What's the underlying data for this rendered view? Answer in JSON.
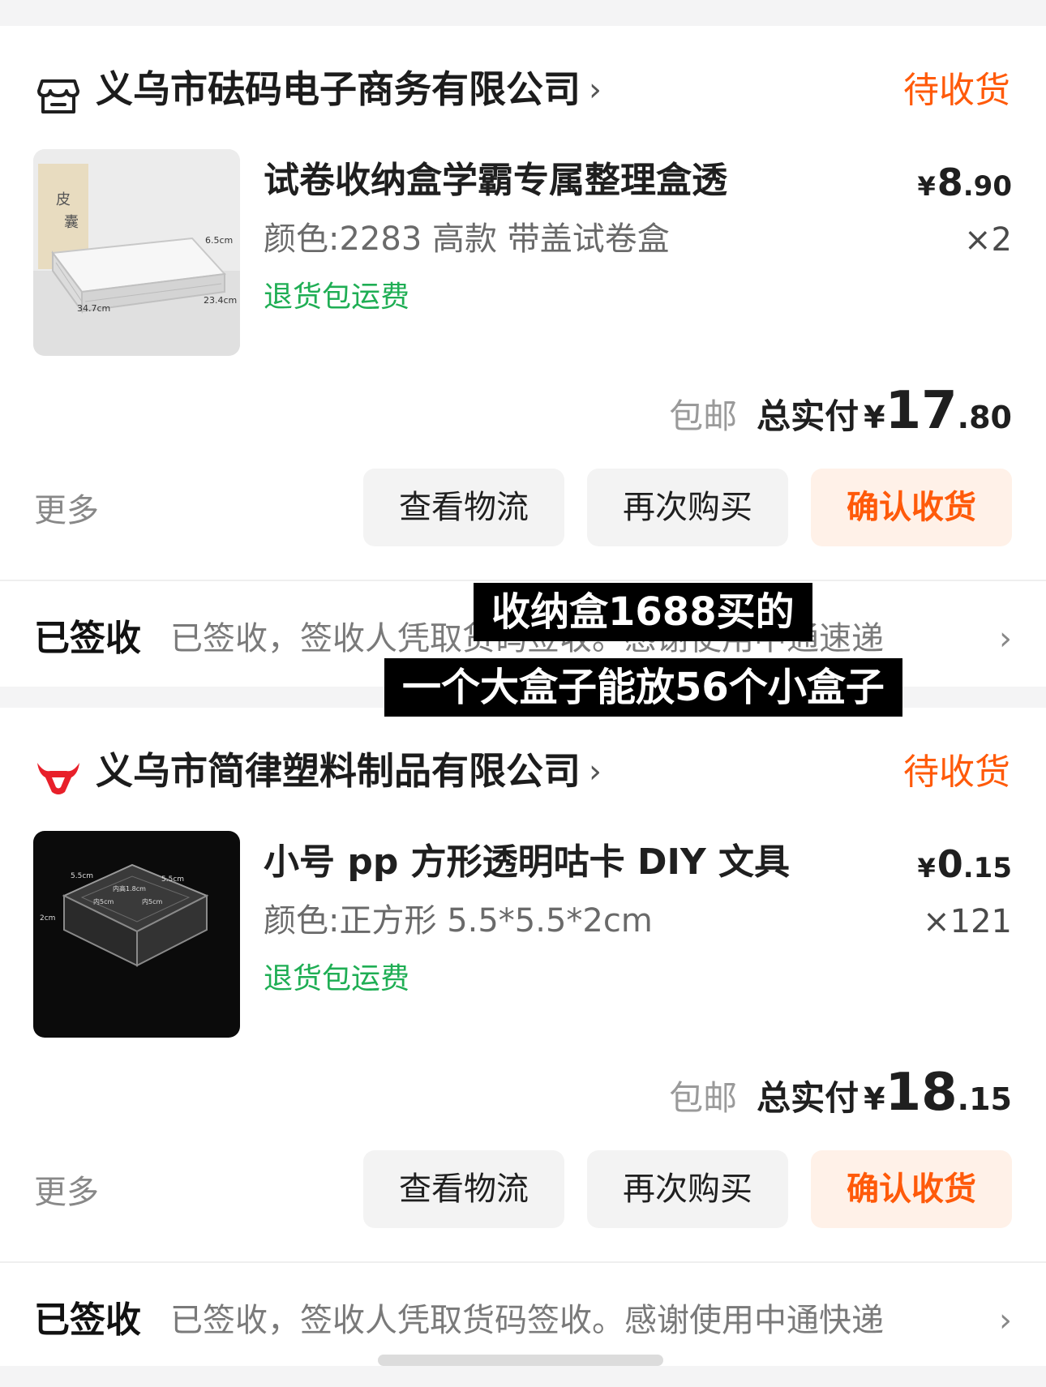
{
  "orders": [
    {
      "store_name": "义乌市砝码电子商务有限公司",
      "store_chevron": "›",
      "status": "待收货",
      "product": {
        "title": "试卷收纳盒学霸专属整理盒透",
        "variant": "颜色:2283 高款 带盖试卷盒",
        "return_tag": "退货包运费",
        "price_currency": "¥",
        "price_int": "8",
        "price_dec": ".90",
        "quantity": "×2",
        "image_labels": {
          "height": "6.5cm",
          "width": "23.4cm",
          "length": "34.7cm"
        }
      },
      "free_shipping": "包邮",
      "total_label": "总实付",
      "total_currency": "¥",
      "total_int": "17",
      "total_dec": ".80",
      "more_label": "更多",
      "buttons": {
        "logistics": "查看物流",
        "rebuy": "再次购买",
        "confirm": "确认收货"
      },
      "tracking": {
        "label": "已签收",
        "text": "已签收，签收人凭取货码签收。感谢使用中通速递",
        "chevron": "›"
      }
    },
    {
      "store_name": "义乌市简律塑料制品有限公司",
      "store_chevron": "›",
      "status": "待收货",
      "product": {
        "title": "小号 pp 方形透明咕卡 DIY 文具",
        "variant": "颜色:正方形 5.5*5.5*2cm",
        "return_tag": "退货包运费",
        "price_currency": "¥",
        "price_int": "0",
        "price_dec": ".15",
        "quantity": "×121",
        "image_labels": {
          "side_a": "5.5cm",
          "side_b": "5.5cm",
          "height": "2cm",
          "inner_height": "内高1.8cm",
          "inner_a": "内5cm",
          "inner_b": "内5cm"
        }
      },
      "free_shipping": "包邮",
      "total_label": "总实付",
      "total_currency": "¥",
      "total_int": "18",
      "total_dec": ".15",
      "more_label": "更多",
      "buttons": {
        "logistics": "查看物流",
        "rebuy": "再次购买",
        "confirm": "确认收货"
      },
      "tracking": {
        "label": "已签收",
        "text": "已签收，签收人凭取货码签收。感谢使用中通快递",
        "chevron": "›"
      }
    }
  ],
  "caption": {
    "line1": "收纳盒1688买的",
    "line2": "一个大盒子能放56个小盒子"
  },
  "colors": {
    "accent": "#ff5a0a",
    "green": "#1fae54",
    "bull_red": "#e8202a"
  }
}
